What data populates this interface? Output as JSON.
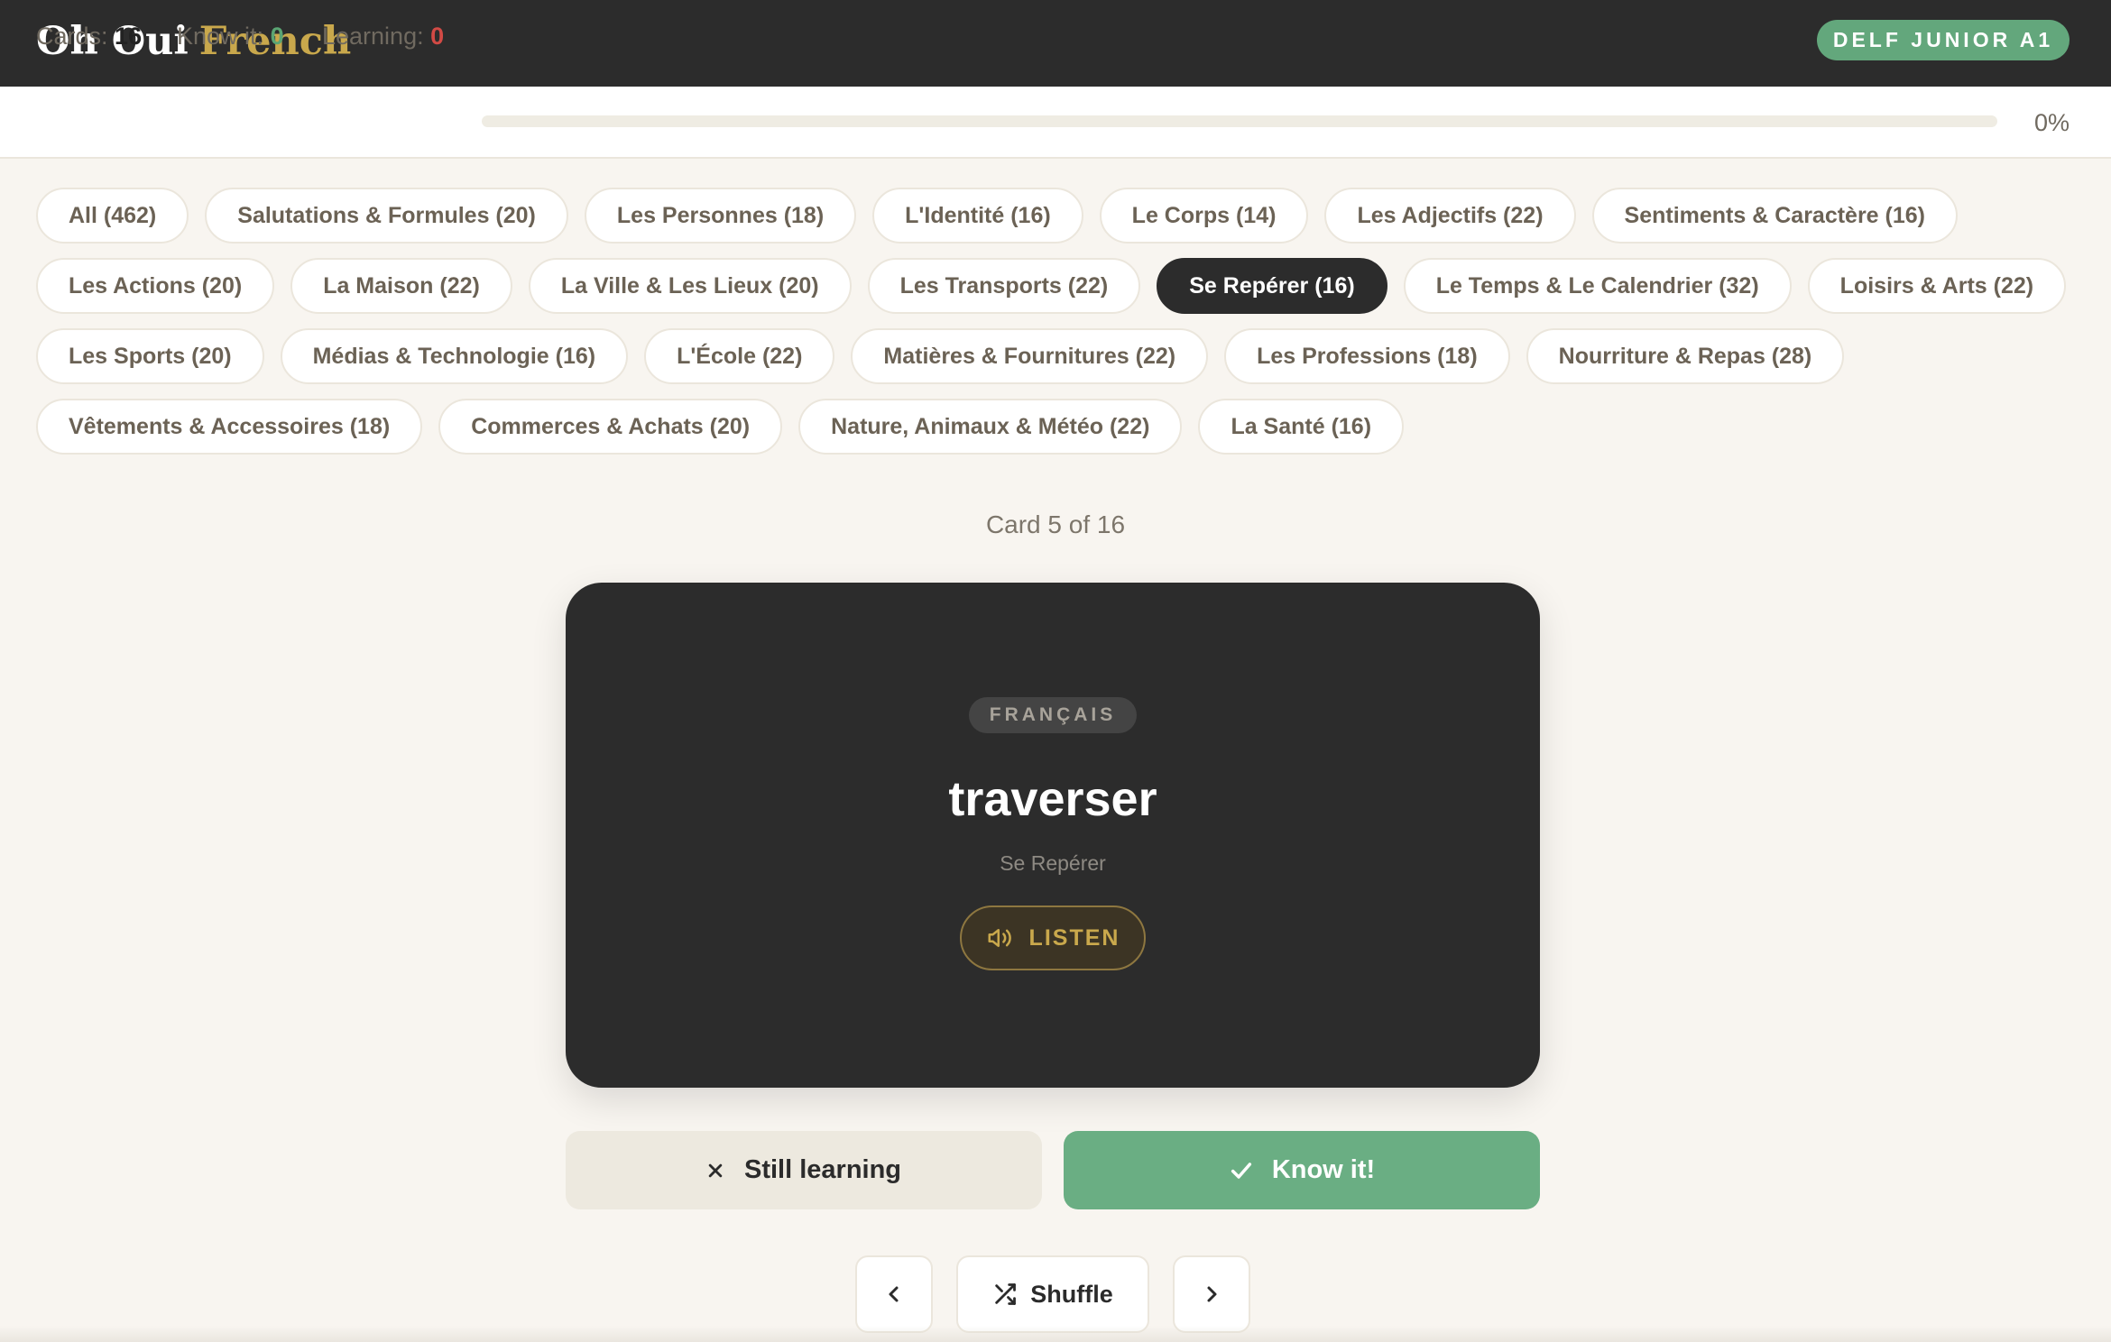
{
  "header": {
    "logo_part1": "Oh Oui",
    "logo_part2": "French",
    "level_badge": "DELF JUNIOR A1"
  },
  "stats": {
    "cards_label": "Cards:",
    "cards_value": "16",
    "know_label": "Know it:",
    "know_value": "0",
    "learning_label": "Learning:",
    "learning_value": "0",
    "progress_text": "0%",
    "progress_fraction": 0
  },
  "categories": [
    {
      "label": "All (462)"
    },
    {
      "label": "Salutations & Formules (20)"
    },
    {
      "label": "Les Personnes (18)"
    },
    {
      "label": "L'Identité (16)"
    },
    {
      "label": "Le Corps (14)"
    },
    {
      "label": "Les Adjectifs (22)"
    },
    {
      "label": "Sentiments & Caractère (16)"
    },
    {
      "label": "Les Actions (20)"
    },
    {
      "label": "La Maison (22)"
    },
    {
      "label": "La Ville & Les Lieux (20)"
    },
    {
      "label": "Les Transports (22)"
    },
    {
      "label": "Se Repérer (16)",
      "active": true
    },
    {
      "label": "Le Temps & Le Calendrier (32)"
    },
    {
      "label": "Loisirs & Arts (22)"
    },
    {
      "label": "Les Sports (20)"
    },
    {
      "label": "Médias & Technologie (16)"
    },
    {
      "label": "L'École (22)"
    },
    {
      "label": "Matières & Fournitures (22)"
    },
    {
      "label": "Les Professions (18)"
    },
    {
      "label": "Nourriture & Repas (28)"
    },
    {
      "label": "Vêtements & Accessoires (18)"
    },
    {
      "label": "Commerces & Achats (20)"
    },
    {
      "label": "Nature, Animaux & Météo (22)"
    },
    {
      "label": "La Santé (16)"
    }
  ],
  "card": {
    "counter": "Card 5 of 16",
    "language": "FRANÇAIS",
    "word": "traverser",
    "category": "Se Repérer",
    "listen_label": "LISTEN",
    "listen_icon": "speaker-icon"
  },
  "actions": {
    "still_learning_label": "Still learning",
    "still_learning_icon": "close-icon",
    "know_it_label": "Know it!",
    "know_it_icon": "check-icon"
  },
  "navigation": {
    "prev_icon": "chevron-left-icon",
    "shuffle_label": "Shuffle",
    "shuffle_icon": "shuffle-icon",
    "next_icon": "chevron-right-icon"
  },
  "colors": {
    "header_bg": "#2c2c2c",
    "accent_gold": "#c9a84c",
    "accent_green": "#63a77c",
    "learning_red": "#d24a45",
    "page_bg": "#f8f5f0"
  }
}
